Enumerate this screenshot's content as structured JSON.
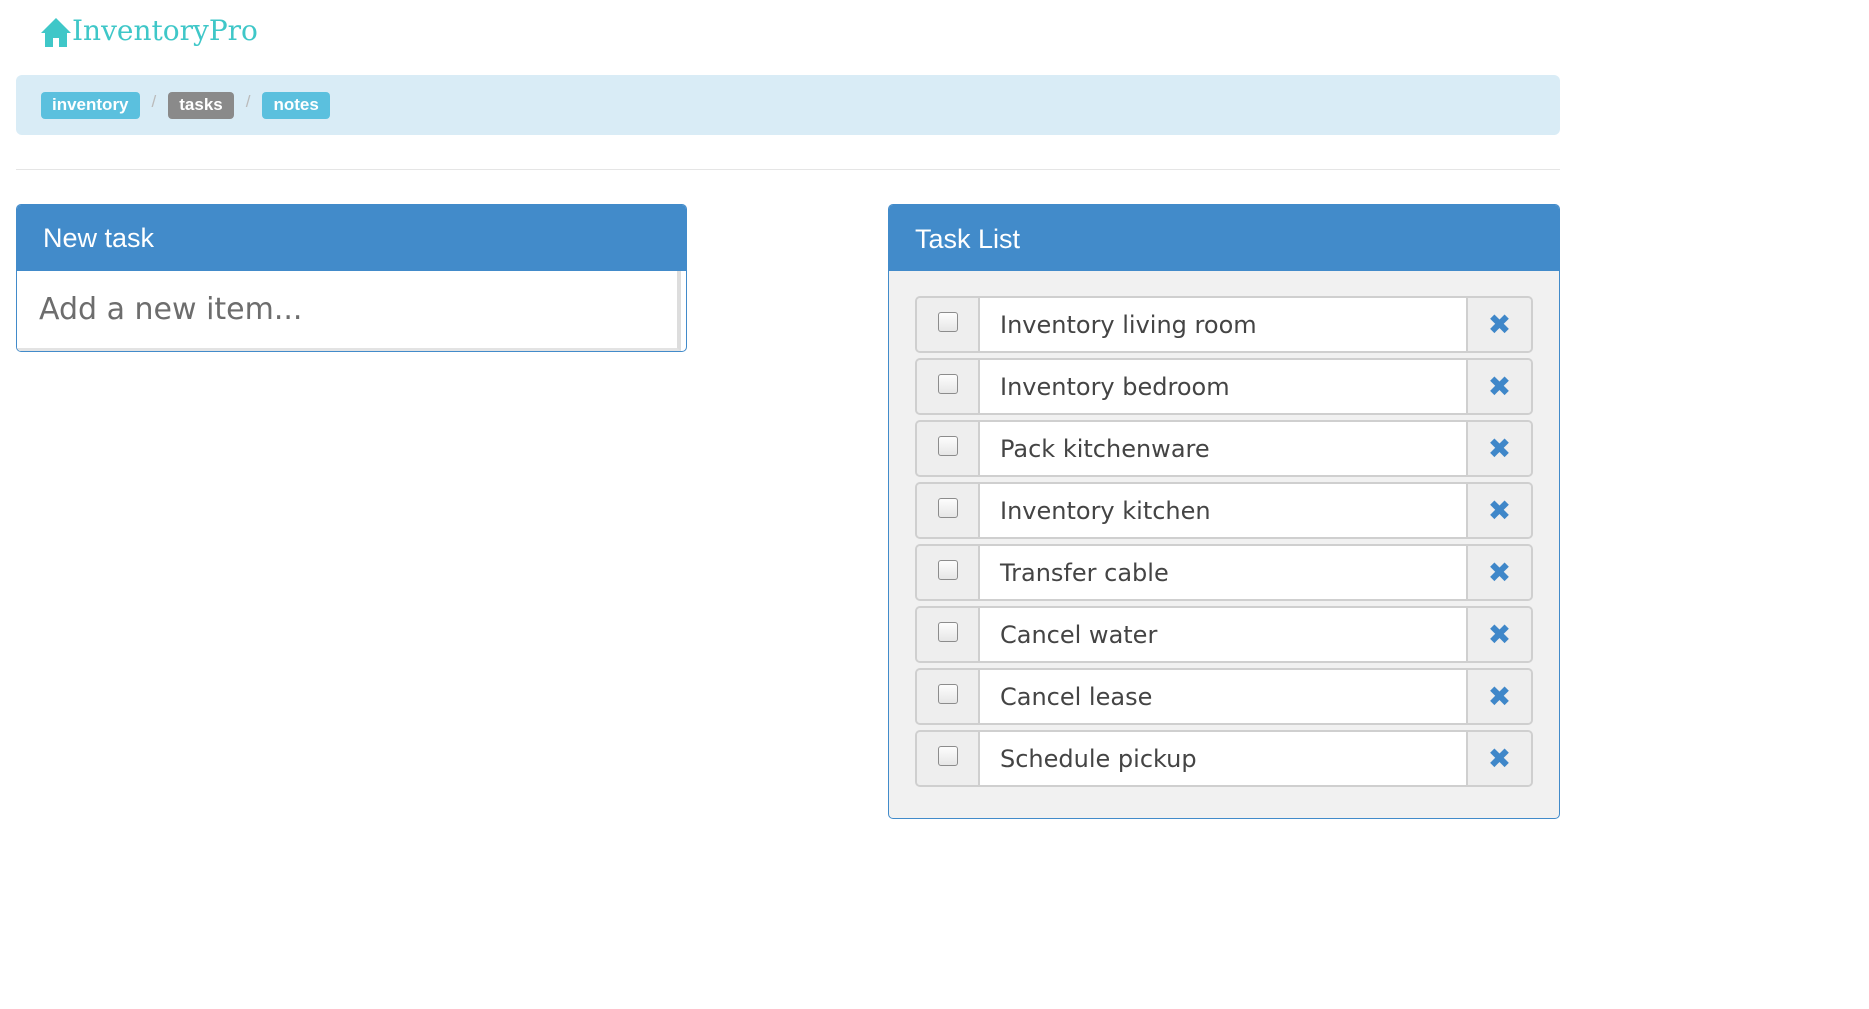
{
  "brand": {
    "name": "InventoryPro",
    "icon": "home-icon",
    "color": "#3fc7c8"
  },
  "breadcrumb": [
    {
      "label": "inventory",
      "style": "info"
    },
    {
      "label": "tasks",
      "style": "muted"
    },
    {
      "label": "notes",
      "style": "info"
    }
  ],
  "breadcrumb_separator": "/",
  "new_task": {
    "heading": "New task",
    "input_value": "",
    "input_placeholder": "Add a new item..."
  },
  "task_list": {
    "heading": "Task List",
    "delete_icon": "close-icon",
    "items": [
      {
        "label": "Inventory living room",
        "checked": false
      },
      {
        "label": "Inventory bedroom",
        "checked": false
      },
      {
        "label": "Pack kitchenware",
        "checked": false
      },
      {
        "label": "Inventory kitchen",
        "checked": false
      },
      {
        "label": "Transfer cable",
        "checked": false
      },
      {
        "label": "Cancel water",
        "checked": false
      },
      {
        "label": "Cancel lease",
        "checked": false
      },
      {
        "label": "Schedule pickup",
        "checked": false
      }
    ]
  },
  "colors": {
    "primary": "#428bca",
    "breadcrumb_bg": "#d9ecf6",
    "label_info": "#5bc0de",
    "label_muted": "#8a8a8a"
  }
}
